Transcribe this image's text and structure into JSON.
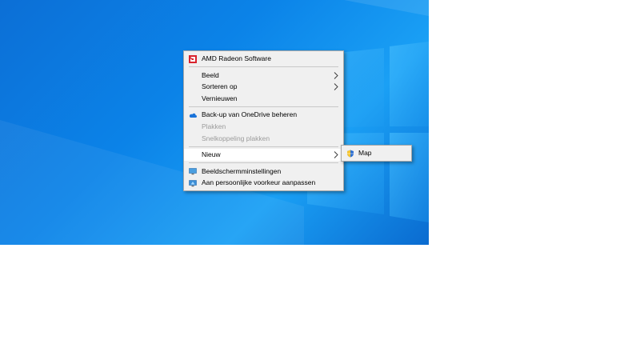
{
  "desktop": {
    "background_color": "#0b83e8"
  },
  "context_menu": {
    "amd": {
      "label": "AMD Radeon Software",
      "icon": "amd-radeon-icon"
    },
    "beeld": {
      "label": "Beeld"
    },
    "sorteren": {
      "label": "Sorteren op"
    },
    "vernieuwen": {
      "label": "Vernieuwen"
    },
    "onedrive": {
      "label": "Back-up van OneDrive beheren",
      "icon": "onedrive-cloud-icon"
    },
    "plakken": {
      "label": "Plakken"
    },
    "snelkoppeling": {
      "label": "Snelkoppeling plakken"
    },
    "nieuw": {
      "label": "Nieuw"
    },
    "beeldscherm": {
      "label": "Beeldschermminstellingen",
      "icon": "display-settings-icon"
    },
    "persoonlijk": {
      "label": "Aan persoonlijke voorkeur aanpassen",
      "icon": "personalize-icon"
    }
  },
  "submenu_nieuw": {
    "map": {
      "label": "Map",
      "icon": "shield-folder-icon"
    }
  }
}
